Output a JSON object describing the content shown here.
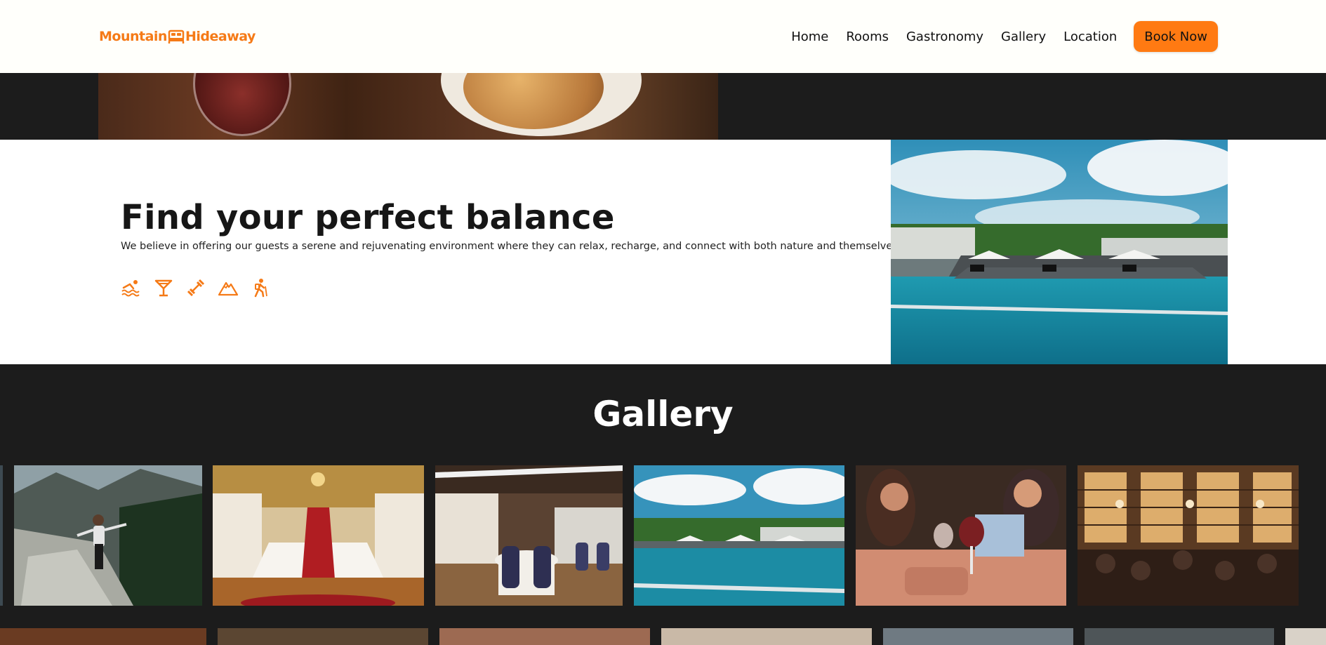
{
  "header": {
    "logo_left": "Mountain",
    "logo_right": "Hideaway",
    "nav": [
      {
        "label": "Home"
      },
      {
        "label": "Rooms"
      },
      {
        "label": "Gastronomy"
      },
      {
        "label": "Gallery"
      },
      {
        "label": "Location"
      }
    ],
    "book_label": "Book Now"
  },
  "balance": {
    "title": "Find your perfect balance",
    "text": "We believe in offering our guests a serene and rejuvenating environment where they can relax, recharge, and connect with both nature and themselves.",
    "icons": [
      "swimming-icon",
      "cocktail-icon",
      "dumbbell-icon",
      "mountain-icon",
      "hiking-icon"
    ]
  },
  "gallery": {
    "title": "Gallery",
    "images": [
      "hiker-mountain-image",
      "grand-staircase-image",
      "dining-room-image",
      "pool-image",
      "friends-wine-image",
      "bar-image"
    ]
  },
  "colors": {
    "accent": "#ff7a12",
    "dark": "#1c1c1c"
  }
}
